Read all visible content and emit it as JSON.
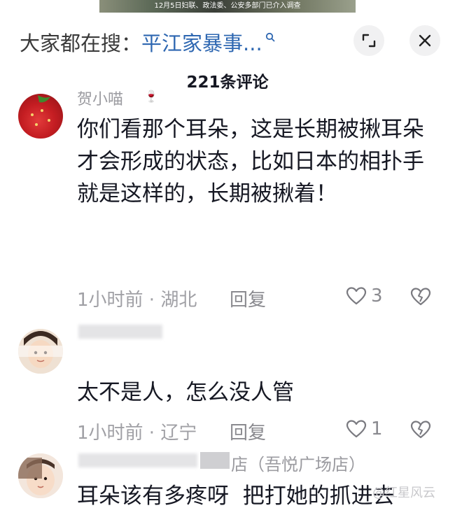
{
  "video": {
    "caption": "12月5日妇联、政法委、公安多部门已介入调查"
  },
  "header": {
    "search_prefix": "大家都在搜：",
    "search_term": "平江家暴事...",
    "comment_count": "221条评论"
  },
  "comments": [
    {
      "username": "贺小喵",
      "text": "你们看那个耳朵，这是长期被揪耳朵才会形成的状态，比如日本的相扑手就是这样的，长期被揪着！",
      "time_location": "1小时前 · 湖北",
      "reply_label": "回复",
      "likes": "3"
    },
    {
      "username": "",
      "text": "太不是人，怎么没人管",
      "time_location": "1小时前 · 辽宁",
      "reply_label": "回复",
      "likes": "1"
    },
    {
      "username": "店（吾悦广场店）",
      "text": "耳朵该有多疼呀  把打她的抓进去",
      "time_location": "",
      "reply_label": "",
      "likes": ""
    }
  ],
  "watermark": "@红星风云",
  "colors": {
    "link_blue": "#2e67b1",
    "text_dark": "#161823",
    "meta_gray": "#a0a0a5",
    "button_bg": "#f1f1f2"
  },
  "icons": [
    "search-icon",
    "expand-icon",
    "close-icon",
    "heart-outline-icon",
    "broken-heart-icon"
  ]
}
